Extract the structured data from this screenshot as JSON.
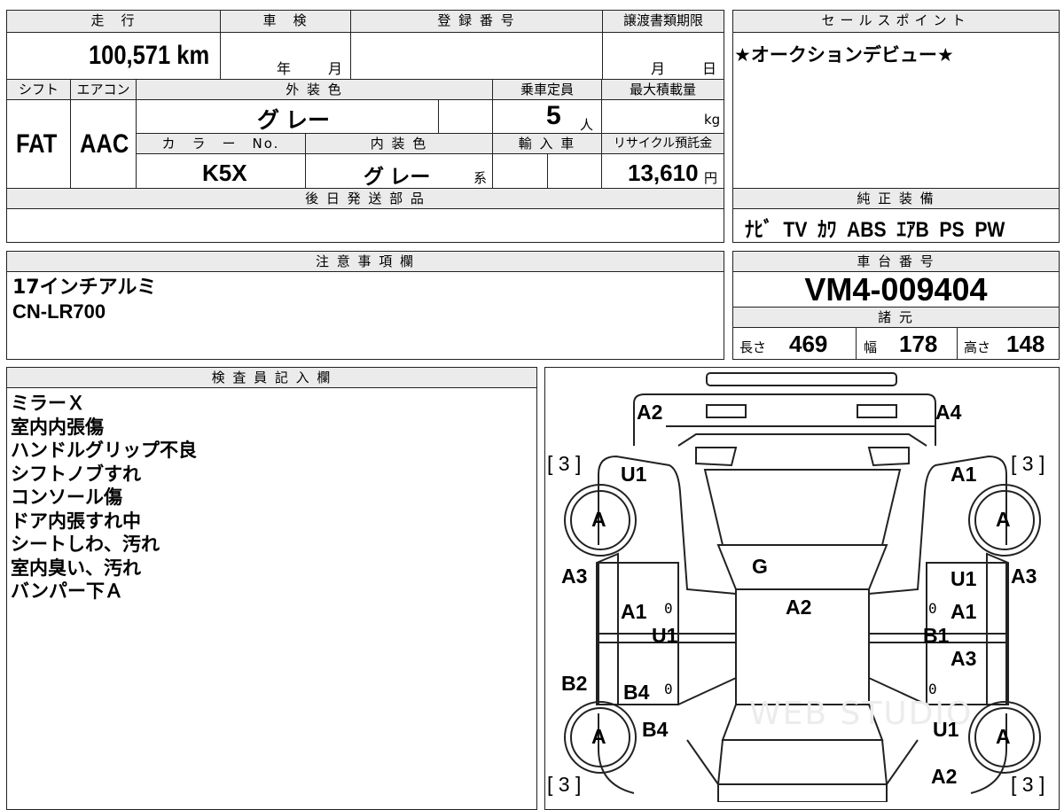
{
  "top_block": {
    "labels": {
      "mileage": "走　行",
      "inspection": "車　検",
      "registration": "登 録 番 号",
      "transfer_deadline": "譲渡書類期限",
      "shift": "シフト",
      "aircon": "エアコン",
      "exterior_color": "外 装 色",
      "capacity": "乗車定員",
      "max_load": "最大積載量",
      "color_no": "カ　ラ　ー　No.",
      "interior_color": "内 装 色",
      "imported": "輸 入 車",
      "recycle": "リサイクル預託金",
      "ship_later": "後 日 発 送 部 品"
    },
    "values": {
      "mileage": "100,571 km",
      "inspection_year": "年",
      "inspection_month": "月",
      "transfer_month": "月",
      "transfer_day": "日",
      "shift": "FAT",
      "aircon": "AAC",
      "exterior_color": "グ レー",
      "capacity": "5",
      "capacity_unit": "人",
      "max_load_unit": "kg",
      "color_no": "K5X",
      "interior_color": "グ レー",
      "interior_suffix": "系",
      "recycle": "13,610",
      "recycle_unit": "円"
    }
  },
  "sales_point": {
    "label": "セールスポイント",
    "text": "★オークションデビュー★"
  },
  "equipment": {
    "label": "純 正 装 備",
    "text": "ﾅﾋﾞ  TV  ｶﾜ  ABS  ｴｱB  PS  PW"
  },
  "notes": {
    "label": "注 意 事 項 欄",
    "lines": [
      "17インチアルミ",
      "CN-LR700"
    ]
  },
  "chassis": {
    "label": "車 台 番 号",
    "number": "VM4-009404",
    "specs_label": "諸 元",
    "length_label": "長さ",
    "length": "469",
    "width_label": "幅",
    "width": "178",
    "height_label": "高さ",
    "height": "148"
  },
  "inspector": {
    "label": "検 査 員 記 入 欄",
    "lines": [
      "ミラーＸ",
      "室内内張傷",
      "ハンドルグリップ不良",
      "シフトノブすれ",
      "コンソール傷",
      "ドア内張すれ中",
      "シートしわ、汚れ",
      "室内臭い、汚れ",
      "バンパー下Ａ"
    ]
  },
  "diagram": {
    "labels": {
      "front_left": "A2",
      "front_right": "A4",
      "fender_left": "U1",
      "fender_right": "A1",
      "tire_fl": "A",
      "tire_fr": "A",
      "tire_rl": "A",
      "tire_rr": "A",
      "tread_fl": "[ 3 ]",
      "tread_fr": "[ 3 ]",
      "tread_rl": "[ 3 ]",
      "tread_rr": "[ 3 ]",
      "windshield": "G",
      "roof": "A2",
      "pillar_left": "A3",
      "pillar_right": "A3",
      "door_fl": "A1",
      "door_fr_top": "U1",
      "door_fr": "A1",
      "sill_left": "U1",
      "sill_right": "B1",
      "door_fr_low": "A3",
      "quarter_left": "B2",
      "door_rl": "B4",
      "rear_left": "B4",
      "rear_right": "U1",
      "rear_bumper_right": "A2",
      "zero_marks": [
        "0",
        "0",
        "0",
        "0"
      ]
    },
    "watermark": "WEB STUDIO"
  }
}
